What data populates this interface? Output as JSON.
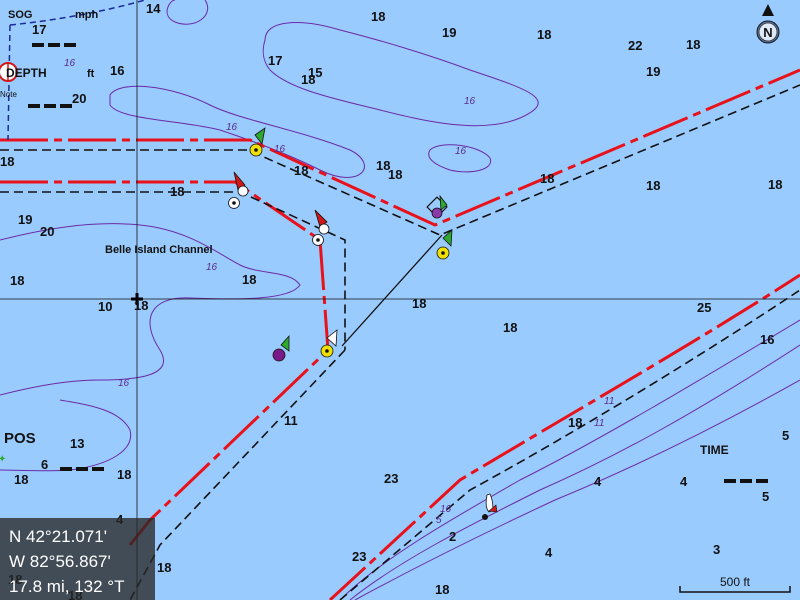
{
  "overlays": {
    "sog": {
      "label": "SOG",
      "unit": "mph",
      "value": "17"
    },
    "depth": {
      "label": "DEPTH",
      "unit": "ft",
      "note": "Note",
      "value": "20"
    },
    "pos": {
      "label": "POS"
    },
    "time": {
      "label": "TIME"
    }
  },
  "compass": {
    "letter": "N"
  },
  "feature": {
    "channel_name": "Belle Island Channel"
  },
  "position": {
    "lat": "N  42°21.071'",
    "lon": "W  82°56.867'",
    "bearing": "17.8 mi, 132 °T"
  },
  "scale": {
    "label": "500 ft"
  },
  "soundings": [
    "14",
    "18",
    "19",
    "18",
    "22",
    "18",
    "19",
    "16",
    "17",
    "15",
    "18",
    "18",
    "18",
    "18",
    "18",
    "18",
    "18",
    "18",
    "19",
    "20",
    "18",
    "18",
    "18",
    "10",
    "18",
    "18",
    "18",
    "25",
    "16",
    "18",
    "11",
    "13",
    "6",
    "18",
    "18",
    "23",
    "4",
    "4",
    "4",
    "5",
    "2",
    "4",
    "3",
    "5",
    "23",
    "18",
    "18",
    "18",
    "18"
  ],
  "contour_labels": [
    "16",
    "16",
    "16",
    "16",
    "16",
    "16",
    "16",
    "11",
    "16",
    "11",
    "5"
  ],
  "colors": {
    "water": "#9acbff",
    "route": "#e8121a",
    "contour": "#6a2aa8",
    "green_marker": "#2ea82e",
    "red_marker": "#d01818",
    "yellow_marker": "#f0e000"
  }
}
